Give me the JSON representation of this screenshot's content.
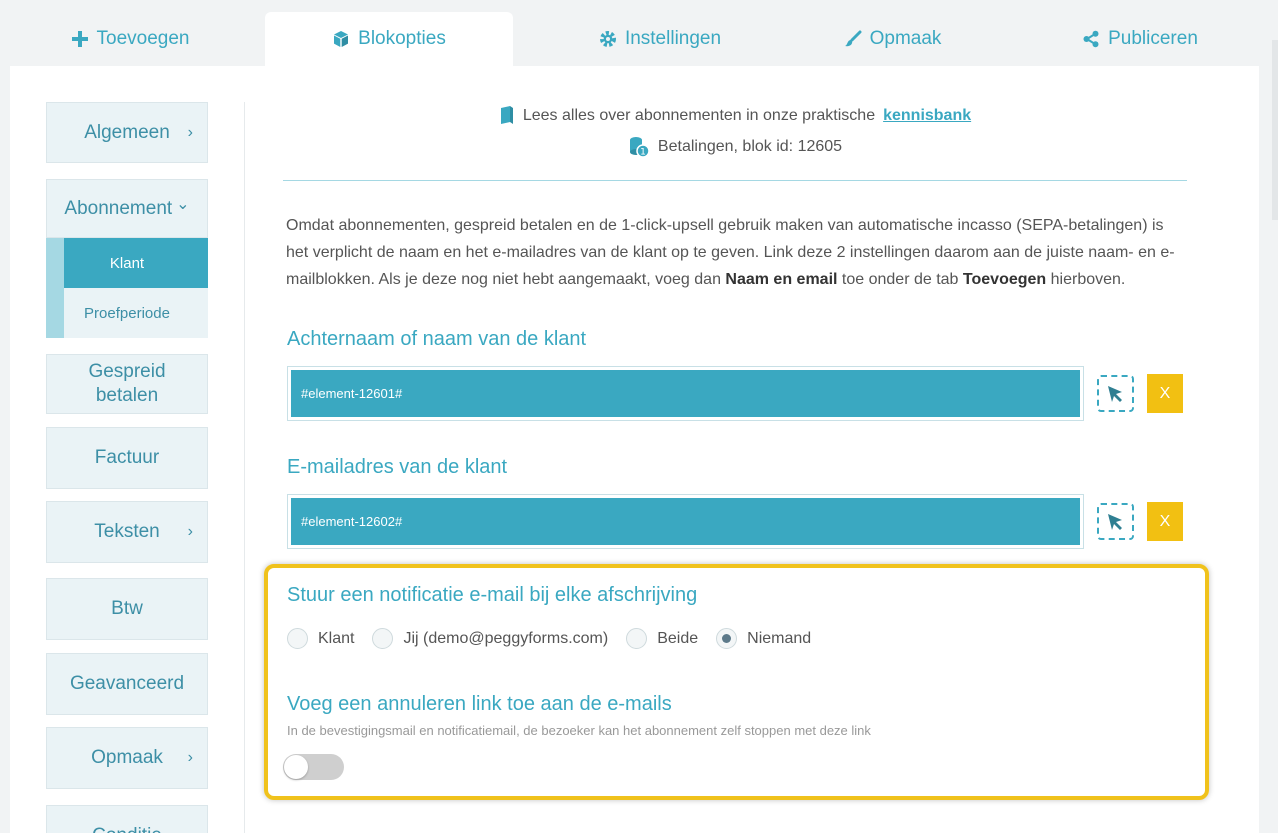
{
  "tabs": [
    {
      "label": "Toevoegen",
      "icon": "plus-icon"
    },
    {
      "label": "Blokopties",
      "icon": "cube-icon",
      "active": true
    },
    {
      "label": "Instellingen",
      "icon": "gear-icon"
    },
    {
      "label": "Opmaak",
      "icon": "brush-icon"
    },
    {
      "label": "Publiceren",
      "icon": "share-icon"
    }
  ],
  "sidebar": {
    "items": [
      {
        "label": "Algemeen",
        "chevron": "›"
      },
      {
        "label": "Abonnement",
        "chevron": "⌄"
      },
      {
        "label": "Gespreid betalen"
      },
      {
        "label": "Factuur"
      },
      {
        "label": "Teksten",
        "chevron": "›"
      },
      {
        "label": "Btw"
      },
      {
        "label": "Geavanceerd"
      },
      {
        "label": "Opmaak",
        "chevron": "›"
      },
      {
        "label": "Conditie"
      }
    ],
    "subitems": [
      {
        "label": "Klant",
        "active": true
      },
      {
        "label": "Proefperiode"
      }
    ]
  },
  "info": {
    "line1_text": "Lees alles over abonnementen in onze praktische",
    "line1_link": "kennisbank",
    "line2": "Betalingen, blok id: 12605"
  },
  "paragraph": {
    "part1": "Omdat abonnementen, gespreid betalen en de 1-click-upsell gebruik maken van automatische incasso (SEPA-betalingen) is het verplicht de naam en het e-mailadres van de klant op te geven. Link deze 2 instellingen daarom aan de juiste naam- en e-mailblokken. Als je deze nog niet hebt aangemaakt, voeg dan ",
    "bold1": "Naam en email",
    "part2": " toe onder de tab ",
    "bold2": "Toevoegen",
    "part3": " hierboven."
  },
  "name_section": {
    "heading": "Achternaam of naam van de klant",
    "value": "#element-12601#",
    "clear_label": "X"
  },
  "email_section": {
    "heading": "E-mailadres van de klant",
    "value": "#element-12602#",
    "clear_label": "X"
  },
  "notification": {
    "heading": "Stuur een notificatie e-mail bij elke afschrijving",
    "options": [
      {
        "label": "Klant",
        "checked": false
      },
      {
        "label": "Jij (demo@peggyforms.com)",
        "checked": false
      },
      {
        "label": "Beide",
        "checked": false
      },
      {
        "label": "Niemand",
        "checked": true
      }
    ]
  },
  "cancel_link": {
    "heading": "Voeg een annuleren link toe aan de e-mails",
    "note": "In de bevestigingsmail en notificatiemail, de bezoeker kan het abonnement zelf stoppen met deze link",
    "enabled": false
  },
  "colors": {
    "accent": "#3aa8c1",
    "highlight": "#f0c21c",
    "clear_button": "#f2c012"
  }
}
